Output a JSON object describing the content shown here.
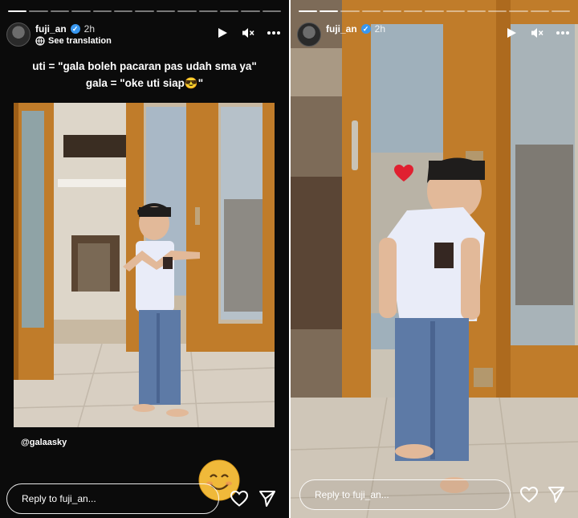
{
  "left_story": {
    "username": "fuji_an",
    "time": "2h",
    "translation_label": "See translation",
    "caption_line1": "uti = \"gala boleh pacaran pas udah sma ya\"",
    "caption_line2": "gala = \"oke uti siap😎\"",
    "mention": "@galaasky",
    "reply_placeholder": "Reply to fuji_an...",
    "sticker_emoji": "😊"
  },
  "right_story": {
    "username": "fuji_an",
    "time": "2h",
    "reply_placeholder": "Reply to fuji_an...",
    "heart_sticker": "❤️"
  },
  "icons": {
    "verified": "verified-badge-icon",
    "play": "play-icon",
    "mute": "muted-speaker-icon",
    "more": "more-options-icon",
    "like": "heart-outline-icon",
    "share": "send-paper-plane-icon",
    "translate": "translate-icon"
  },
  "colors": {
    "story_background": "#0b0b0b",
    "verified_blue": "#3897f0",
    "door_wood": "#c07c2a",
    "uniform_shirt": "#e9ecf8",
    "uniform_pants": "#5d7aa6"
  }
}
